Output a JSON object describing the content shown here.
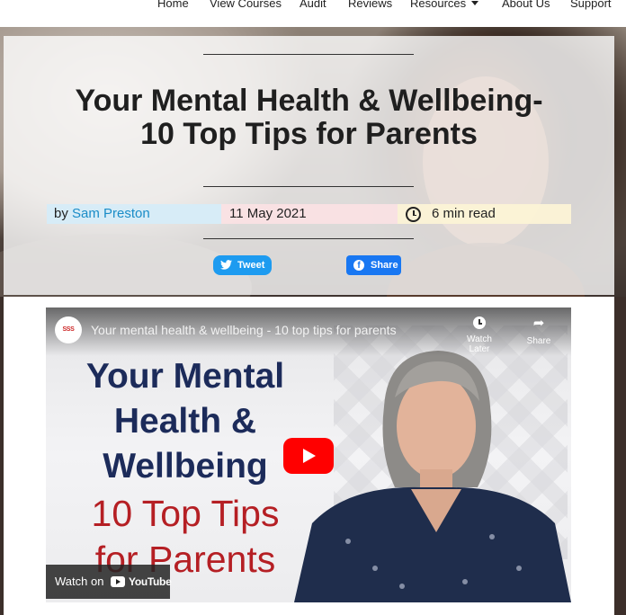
{
  "nav": {
    "items": [
      "Home",
      "View Courses",
      "Audit",
      "Reviews",
      "Resources",
      "About Us",
      "Support"
    ]
  },
  "article": {
    "title_line1": "Your Mental Health & Wellbeing-",
    "title_line2": "10 Top Tips for Parents",
    "by_prefix": "by",
    "author": "Sam Preston",
    "date": "11 May 2021",
    "read_time": "6 min read"
  },
  "share": {
    "tweet_label": "Tweet",
    "facebook_label": "Share"
  },
  "video": {
    "title": "Your mental health & wellbeing - 10 top tips for parents",
    "channel_logo_text": "SSS",
    "watch_later_label": "Watch Later",
    "share_label": "Share",
    "thumbnail_lines": [
      "Your Mental",
      "Health &",
      "Wellbeing"
    ],
    "thumbnail_red_lines": [
      "10 Top Tips",
      "for Parents"
    ],
    "watch_on_label": "Watch on",
    "youtube_label": "YouTube"
  },
  "colors": {
    "author_link": "#1a8cc7",
    "tweet_button": "#1d9bf0",
    "facebook_button": "#1877f2",
    "thumbnail_navy": "#1c2b5a",
    "thumbnail_red": "#b51f24",
    "youtube_red": "#ff0000"
  }
}
